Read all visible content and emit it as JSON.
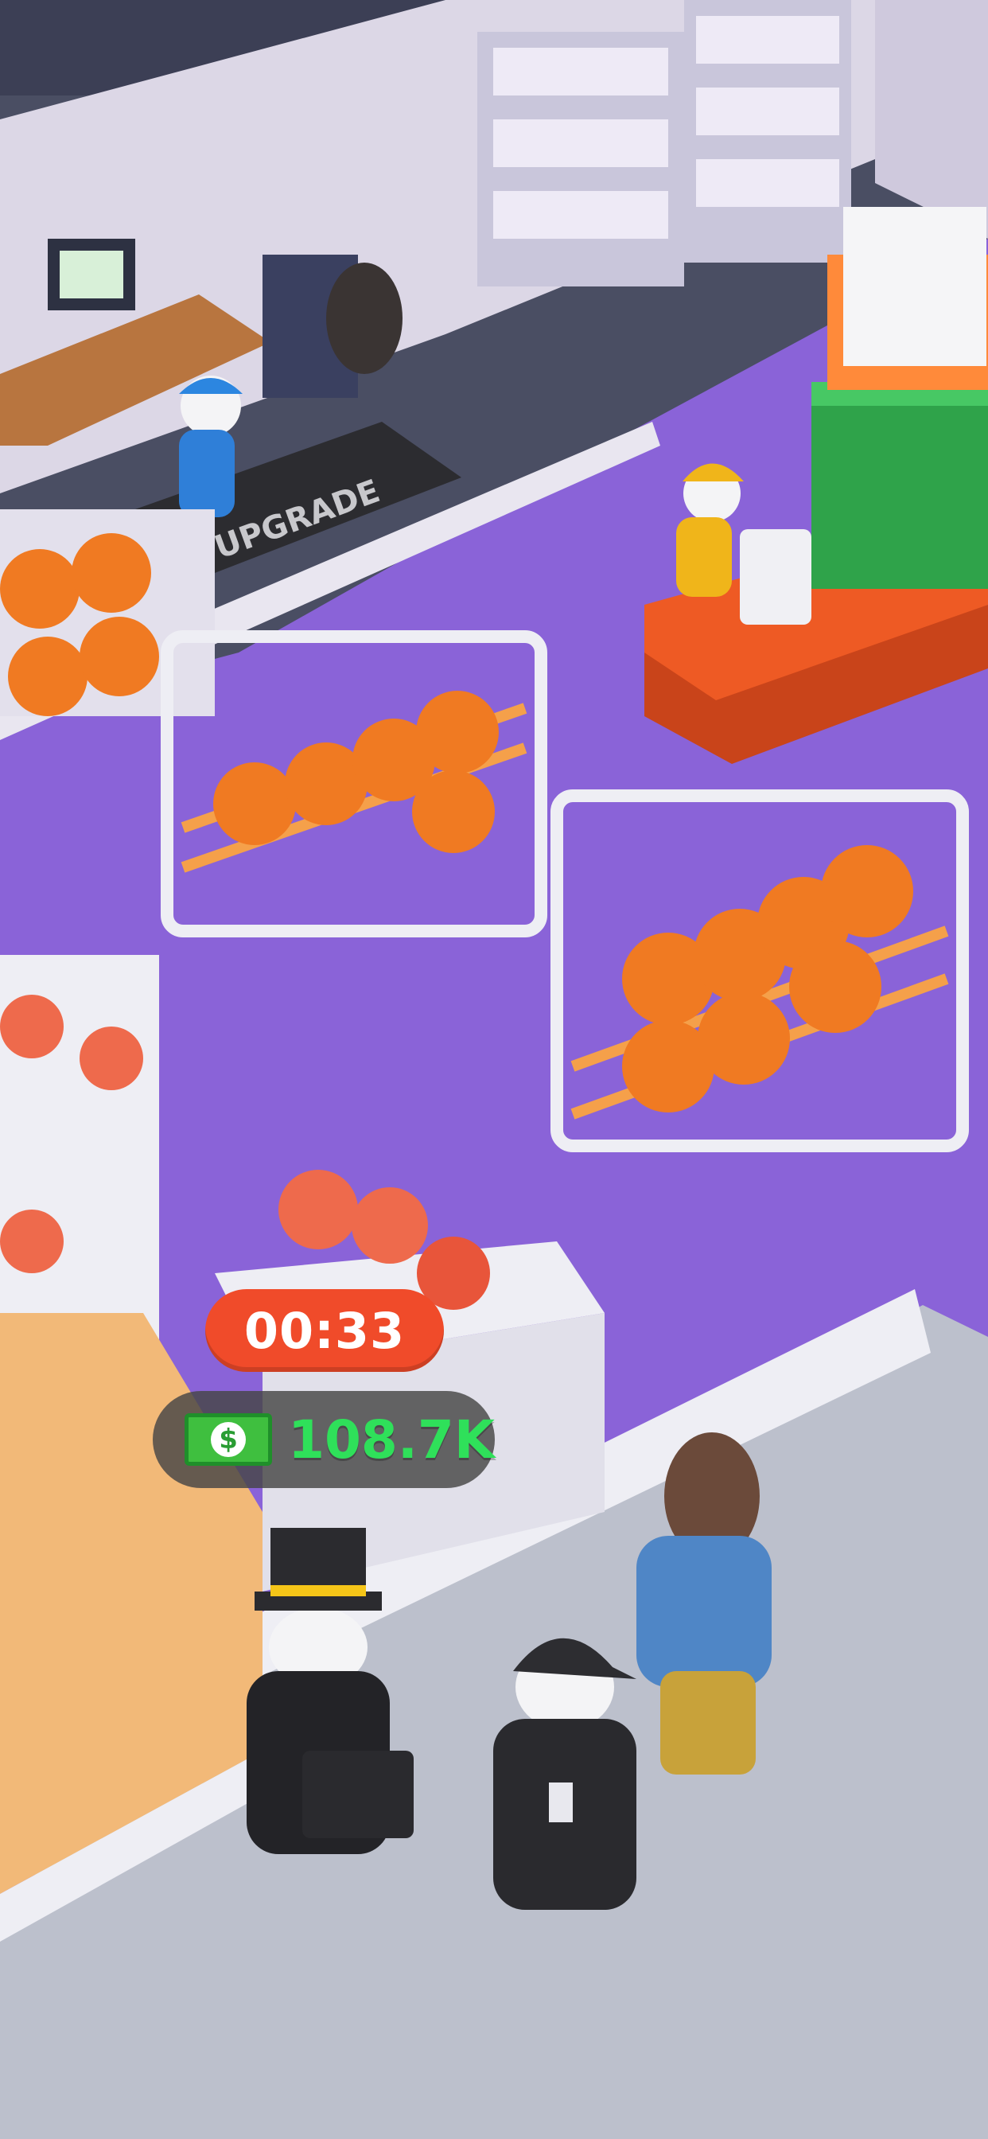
{
  "hud": {
    "timer": "00:33",
    "cash_amount": "108.7K",
    "cash_icon": "dollar-bill-icon"
  },
  "scene": {
    "upgrade_mat_label": "UPGRADE"
  },
  "colors": {
    "floor": "#8a63d8",
    "tile_floor": "#bcc0cc",
    "wood_floor": "#f2b978",
    "timer_bg": "#f04b2a",
    "cash_text": "#2fe05a"
  }
}
